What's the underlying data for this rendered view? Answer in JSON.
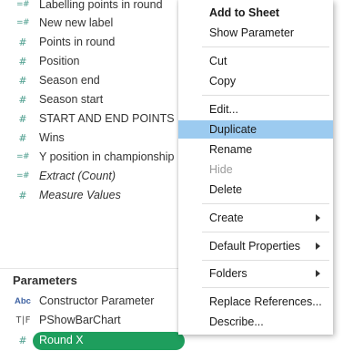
{
  "fields": [
    {
      "icon": "=#",
      "name": "Labelling points in round",
      "italic": false
    },
    {
      "icon": "=#",
      "name": "New new label",
      "italic": false
    },
    {
      "icon": "#",
      "name": "Points in round",
      "italic": false
    },
    {
      "icon": "#",
      "name": "Position",
      "italic": false
    },
    {
      "icon": "#",
      "name": "Season end",
      "italic": false
    },
    {
      "icon": "#",
      "name": "Season start",
      "italic": false
    },
    {
      "icon": "#",
      "name": "START AND END POINTS",
      "italic": false
    },
    {
      "icon": "#",
      "name": "Wins",
      "italic": false
    },
    {
      "icon": "=#",
      "name": "Y position in championship",
      "italic": false
    },
    {
      "icon": "=#",
      "name": "Extract (Count)",
      "italic": true
    },
    {
      "icon": "#",
      "name": "Measure Values",
      "italic": true
    }
  ],
  "parameters_header": "Parameters",
  "parameters": [
    {
      "icon": "Abc",
      "name": "Constructor Parameter"
    },
    {
      "icon": "T|F",
      "name": "PShowBarChart"
    },
    {
      "icon": "#",
      "name": "Round X",
      "selected": true
    }
  ],
  "context_menu": {
    "items": [
      {
        "label": "Add to Sheet",
        "bold": true
      },
      {
        "label": "Show Parameter"
      },
      {
        "label": "Cut"
      },
      {
        "label": "Copy"
      },
      {
        "label": "Edit..."
      },
      {
        "label": "Duplicate",
        "highlighted": true
      },
      {
        "label": "Rename"
      },
      {
        "label": "Hide",
        "disabled": true
      },
      {
        "label": "Delete"
      },
      {
        "label": "Create",
        "submenu": true
      },
      {
        "label": "Default Properties",
        "submenu": true
      },
      {
        "label": "Folders",
        "submenu": true
      },
      {
        "label": "Replace References..."
      },
      {
        "label": "Describe..."
      }
    ]
  },
  "colors": {
    "field_icon": "#4a9c8c",
    "selected_pill": "#1e9e5d",
    "menu_highlight": "#9ccbf0",
    "string_icon": "#3f63a3"
  }
}
